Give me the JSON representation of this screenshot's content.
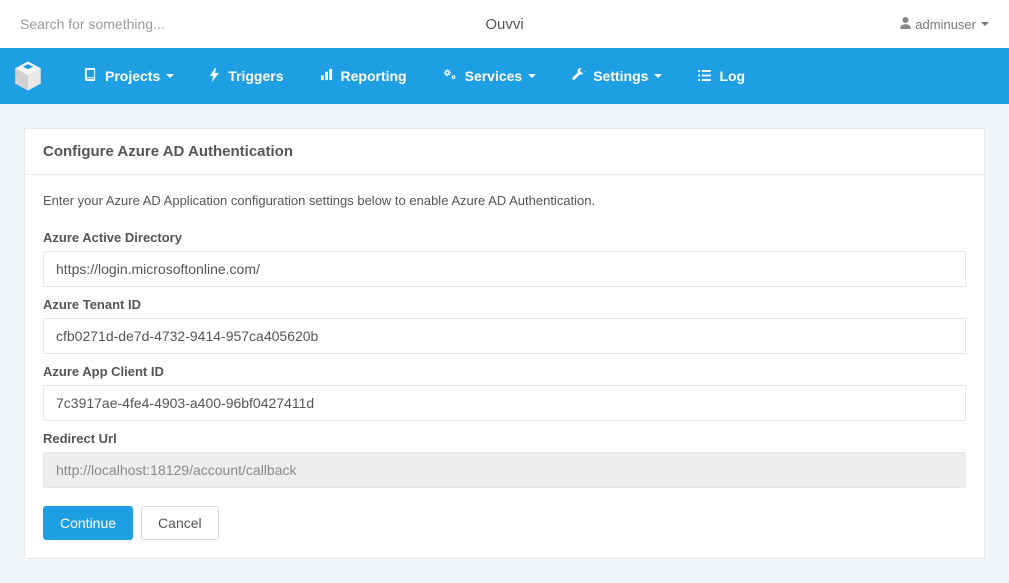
{
  "header": {
    "search_placeholder": "Search for something...",
    "brand": "Ouvvi",
    "username": "adminuser"
  },
  "nav": {
    "items": [
      {
        "label": "Projects",
        "icon": "book",
        "dropdown": true
      },
      {
        "label": "Triggers",
        "icon": "bolt",
        "dropdown": false
      },
      {
        "label": "Reporting",
        "icon": "chart",
        "dropdown": false
      },
      {
        "label": "Services",
        "icon": "cogs",
        "dropdown": true
      },
      {
        "label": "Settings",
        "icon": "wrench",
        "dropdown": true
      },
      {
        "label": "Log",
        "icon": "list",
        "dropdown": false
      }
    ]
  },
  "page": {
    "title": "Configure Azure AD Authentication",
    "intro": "Enter your Azure AD Application configuration settings below to enable Azure AD Authentication.",
    "fields": {
      "aad_label": "Azure Active Directory",
      "aad_value": "https://login.microsoftonline.com/",
      "tenant_label": "Azure Tenant ID",
      "tenant_value": "cfb0271d-de7d-4732-9414-957ca405620b",
      "client_label": "Azure App Client ID",
      "client_value": "7c3917ae-4fe4-4903-a400-96bf0427411d",
      "redirect_label": "Redirect Url",
      "redirect_value": "http://localhost:18129/account/callback"
    },
    "buttons": {
      "continue": "Continue",
      "cancel": "Cancel"
    }
  }
}
